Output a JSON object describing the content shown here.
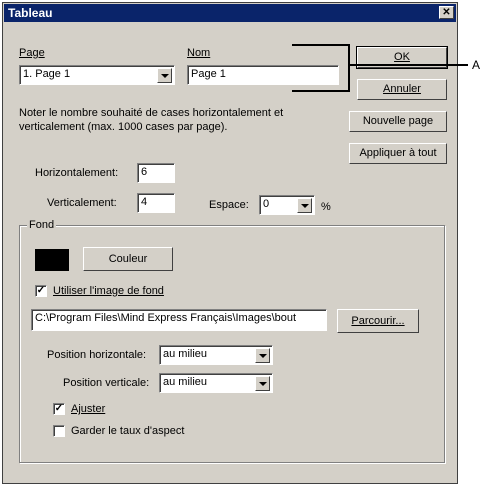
{
  "window": {
    "title": "Tableau",
    "close_glyph": "✕"
  },
  "page": {
    "label": "Page",
    "value": "1. Page 1"
  },
  "nom": {
    "label": "Nom",
    "value": "Page 1"
  },
  "buttons": {
    "ok": "OK",
    "annuler": "Annuler",
    "nouvelle_page": "Nouvelle page",
    "appliquer": "Appliquer à tout",
    "couleur": "Couleur",
    "parcourir": "Parcourir..."
  },
  "info": {
    "line1": "Noter le nombre souhaité de cases horizontalement et",
    "line2": "verticalement (max. 1000 cases par page)."
  },
  "grid": {
    "horizontal_label": "Horizontalement:",
    "horizontal_value": "6",
    "vertical_label": "Verticalement:",
    "vertical_value": "4",
    "espace_label": "Espace:",
    "espace_value": "0",
    "espace_unit": "%"
  },
  "fond": {
    "group_label": "Fond",
    "color": "#000000",
    "use_image_label": "Utiliser l'image de fond",
    "use_image_checked": true,
    "check_glyph": "✓",
    "path": "C:\\Program Files\\Mind Express Français\\Images\\bout",
    "pos_h_label": "Position horizontale:",
    "pos_h_value": "au milieu",
    "pos_v_label": "Position verticale:",
    "pos_v_value": "au milieu",
    "ajuster_label": "Ajuster",
    "ajuster_checked": true,
    "garder_label": "Garder le taux d'aspect",
    "garder_checked": false
  },
  "annotation": {
    "label": "A"
  }
}
